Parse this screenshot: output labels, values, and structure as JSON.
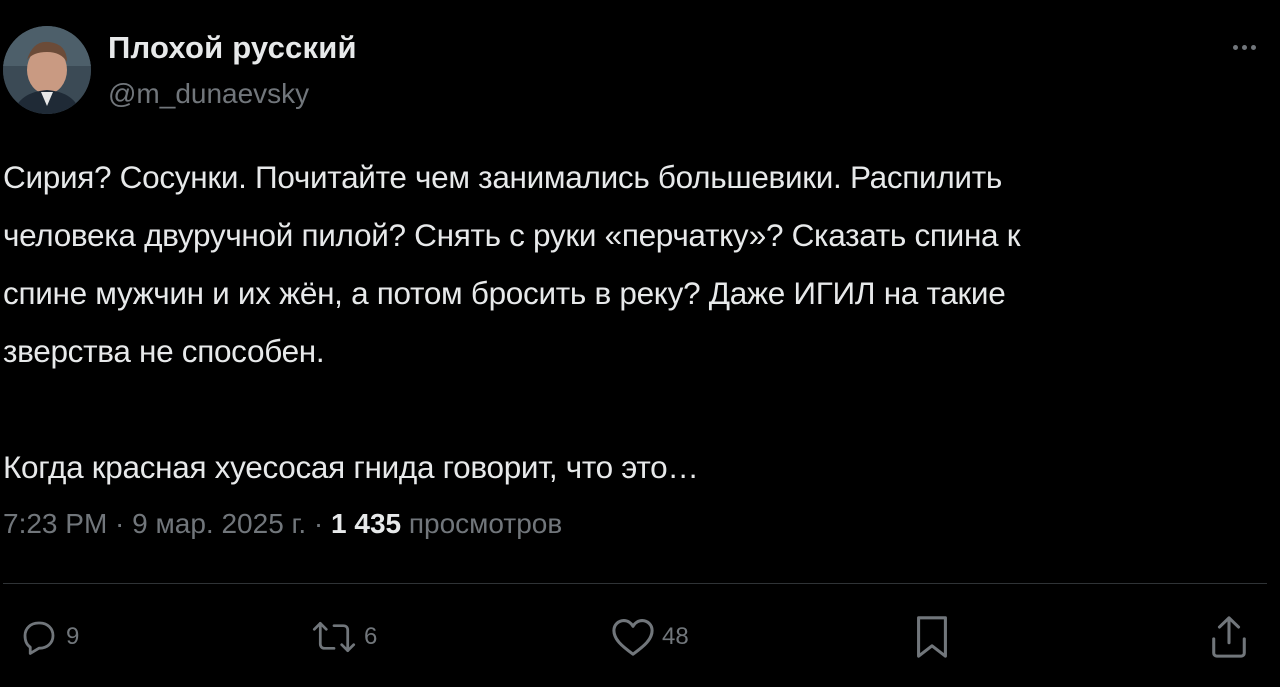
{
  "author": {
    "display_name": "Плохой русский",
    "handle": "@m_dunaevsky"
  },
  "tweet": {
    "lines": [
      "Сирия? Сосунки. Почитайте чем занимались большевики. Распилить",
      "человека двуручной пилой? Снять с руки «перчатку»? Сказать спина к",
      "спине мужчин и их жён, а потом бросить в реку? Даже ИГИЛ на такие",
      "зверства не способен.",
      "Когда красная хуесосая гнида говорит, что это…"
    ]
  },
  "meta": {
    "time": "7:23 PM",
    "separator": " · ",
    "date": "9 мар. 2025 г.",
    "views_count": "1 435",
    "views_label": " просмотров"
  },
  "actions": {
    "replies": "9",
    "reposts": "6",
    "likes": "48"
  },
  "icons": {
    "more": "more-icon",
    "reply": "reply-icon",
    "repost": "repost-icon",
    "like": "heart-icon",
    "bookmark": "bookmark-icon",
    "share": "share-icon"
  },
  "colors": {
    "background": "#000000",
    "text_primary": "#e7e9ea",
    "text_secondary": "#71767b",
    "divider": "#2f3336"
  }
}
